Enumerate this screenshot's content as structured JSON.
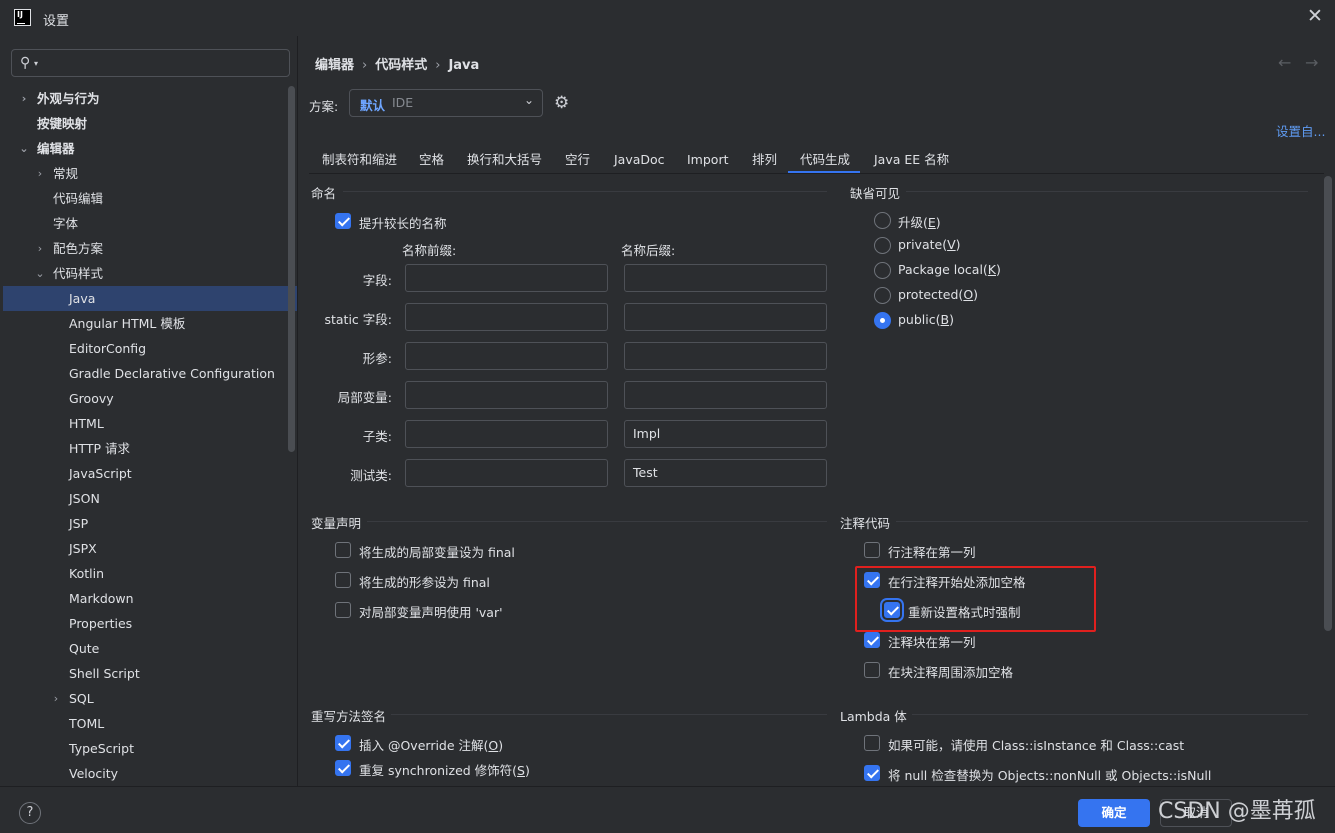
{
  "window": {
    "title": "设置"
  },
  "sidebar": {
    "search_placeholder": "",
    "items": [
      {
        "label": "外观与行为"
      },
      {
        "label": "按键映射"
      },
      {
        "label": "编辑器"
      },
      {
        "label": "常规"
      },
      {
        "label": "代码编辑"
      },
      {
        "label": "字体"
      },
      {
        "label": "配色方案"
      },
      {
        "label": "代码样式"
      },
      {
        "label": "Java"
      },
      {
        "label": "Angular HTML 模板"
      },
      {
        "label": "EditorConfig"
      },
      {
        "label": "Gradle Declarative Configuration"
      },
      {
        "label": "Groovy"
      },
      {
        "label": "HTML"
      },
      {
        "label": "HTTP 请求"
      },
      {
        "label": "JavaScript"
      },
      {
        "label": "JSON"
      },
      {
        "label": "JSP"
      },
      {
        "label": "JSPX"
      },
      {
        "label": "Kotlin"
      },
      {
        "label": "Markdown"
      },
      {
        "label": "Properties"
      },
      {
        "label": "Qute"
      },
      {
        "label": "Shell Script"
      },
      {
        "label": "SQL"
      },
      {
        "label": "TOML"
      },
      {
        "label": "TypeScript"
      },
      {
        "label": "Velocity"
      }
    ]
  },
  "breadcrumb": [
    "编辑器",
    "代码样式",
    "Java"
  ],
  "nav": {
    "back": "←",
    "forward": "→"
  },
  "scheme": {
    "label": "方案:",
    "value": "默认",
    "sub": "IDE"
  },
  "set_from": "设置自...",
  "tabs": [
    "制表符和缩进",
    "空格",
    "换行和大括号",
    "空行",
    "JavaDoc",
    "Import",
    "排列",
    "代码生成",
    "Java EE 名称"
  ],
  "active_tab": "代码生成",
  "naming": {
    "title": "命名",
    "prefer_longer": {
      "label": "提升较长的名称",
      "checked": true
    },
    "prefix_header": "名称前缀:",
    "suffix_header": "名称后缀:",
    "rows": [
      {
        "label": "字段:",
        "prefix": "",
        "suffix": ""
      },
      {
        "label": "static 字段:",
        "prefix": "",
        "suffix": ""
      },
      {
        "label": "形参:",
        "prefix": "",
        "suffix": ""
      },
      {
        "label": "局部变量:",
        "prefix": "",
        "suffix": ""
      },
      {
        "label": "子类:",
        "prefix": "",
        "suffix": "Impl"
      },
      {
        "label": "测试类:",
        "prefix": "",
        "suffix": "Test"
      }
    ]
  },
  "visibility": {
    "title": "缺省可见",
    "options": [
      {
        "label": "升级(",
        "key": "E",
        "tail": ")",
        "checked": false
      },
      {
        "label": "private(",
        "key": "V",
        "tail": ")",
        "checked": false
      },
      {
        "label": "Package local(",
        "key": "K",
        "tail": ")",
        "checked": false
      },
      {
        "label": "protected(",
        "key": "O",
        "tail": ")",
        "checked": false
      },
      {
        "label": "public(",
        "key": "B",
        "tail": ")",
        "checked": true
      }
    ]
  },
  "variables": {
    "title": "变量声明",
    "options": [
      {
        "label": "将生成的局部变量设为 final",
        "checked": false
      },
      {
        "label": "将生成的形参设为 final",
        "checked": false
      },
      {
        "label": "对局部变量声明使用 'var'",
        "checked": false
      }
    ]
  },
  "comment_code": {
    "title": "注释代码",
    "options": [
      {
        "label": "行注释在第一列",
        "checked": false
      },
      {
        "label": "在行注释开始处添加空格",
        "checked": true
      },
      {
        "label": "重新设置格式时强制",
        "checked": true
      },
      {
        "label": "注释块在第一列",
        "checked": true
      },
      {
        "label": "在块注释周围添加空格",
        "checked": false
      }
    ]
  },
  "override": {
    "title": "重写方法签名",
    "options": [
      {
        "label": "插入 @Override 注解(",
        "key": "O",
        "tail": ")",
        "checked": true
      },
      {
        "label": "重复 synchronized 修饰符(",
        "key": "S",
        "tail": ")",
        "checked": true
      }
    ]
  },
  "lambda": {
    "title": "Lambda 体",
    "options": [
      {
        "label": "如果可能，请使用 Class::isInstance 和 Class::cast",
        "checked": false
      },
      {
        "label": "将 null 检查替换为 Objects::nonNull 或 Objects::isNull",
        "checked": true
      }
    ]
  },
  "footer": {
    "help": "?",
    "ok": "确定",
    "cancel": "取消",
    "watermark": "CSDN @墨苒孤"
  },
  "colors": {
    "accent": "#3574f0",
    "selection": "#2e436e",
    "highlight_box": "#e0201e",
    "background": "#2b2d30"
  }
}
